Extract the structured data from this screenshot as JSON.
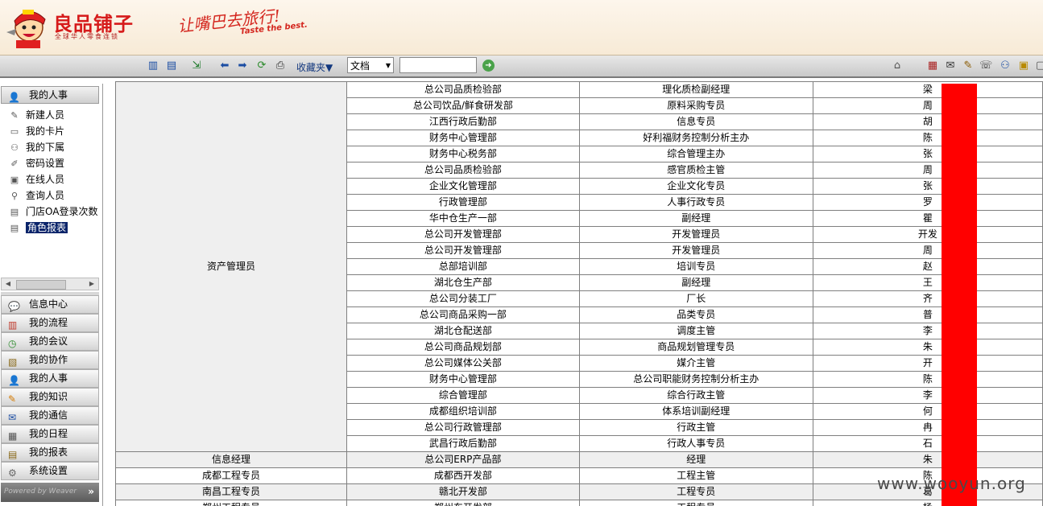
{
  "brand": {
    "logo_text": "良品铺子",
    "logo_subtitle": "全球华人零食连锁",
    "slogan": "让嘴巴去旅行!",
    "slogan_en": "Taste the best."
  },
  "toolbar": {
    "favorites_label": "收藏夹▼",
    "doc_select_value": "文档",
    "search_placeholder": ""
  },
  "sidebar": {
    "tree_header": "我的人事",
    "tree_items": [
      {
        "label": "新建人员",
        "icon": "new-user-icon"
      },
      {
        "label": "我的卡片",
        "icon": "card-icon"
      },
      {
        "label": "我的下属",
        "icon": "subordinate-icon"
      },
      {
        "label": "密码设置",
        "icon": "password-icon"
      },
      {
        "label": "在线人员",
        "icon": "online-icon"
      },
      {
        "label": "查询人员",
        "icon": "search-user-icon"
      },
      {
        "label": "门店OA登录次数",
        "icon": "report-icon"
      },
      {
        "label": "角色报表",
        "icon": "report-icon"
      }
    ],
    "nav_buttons": [
      {
        "label": "信息中心",
        "icon": "chat-icon"
      },
      {
        "label": "我的流程",
        "icon": "flow-icon"
      },
      {
        "label": "我的会议",
        "icon": "meeting-icon"
      },
      {
        "label": "我的协作",
        "icon": "collab-icon"
      },
      {
        "label": "我的人事",
        "icon": "person-icon"
      },
      {
        "label": "我的知识",
        "icon": "knowledge-icon"
      },
      {
        "label": "我的通信",
        "icon": "mail-icon"
      },
      {
        "label": "我的日程",
        "icon": "calendar-icon"
      },
      {
        "label": "我的报表",
        "icon": "report-icon"
      },
      {
        "label": "系统设置",
        "icon": "gear-icon"
      }
    ],
    "footer_text": "Powered by Weaver"
  },
  "table": {
    "group_role": "资产管理员",
    "group_rows": [
      [
        "总公司品质检验部",
        "理化质检副经理",
        "梁"
      ],
      [
        "总公司饮品/鲜食研发部",
        "原料采购专员",
        "周"
      ],
      [
        "江西行政后勤部",
        "信息专员",
        "胡"
      ],
      [
        "财务中心管理部",
        "好利福财务控制分析主办",
        "陈"
      ],
      [
        "财务中心税务部",
        "综合管理主办",
        "张"
      ],
      [
        "总公司品质检验部",
        "感官质检主管",
        "周"
      ],
      [
        "企业文化管理部",
        "企业文化专员",
        "张"
      ],
      [
        "行政管理部",
        "人事行政专员",
        "罗"
      ],
      [
        "华中仓生产一部",
        "副经理",
        "瞿"
      ],
      [
        "总公司开发管理部",
        "开发管理员",
        "开发"
      ],
      [
        "总公司开发管理部",
        "开发管理员",
        "周"
      ],
      [
        "总部培训部",
        "培训专员",
        "赵"
      ],
      [
        "湖北仓生产部",
        "副经理",
        "王"
      ],
      [
        "总公司分装工厂",
        "厂长",
        "齐"
      ],
      [
        "总公司商品采购一部",
        "品类专员",
        "普"
      ],
      [
        "湖北仓配送部",
        "调度主管",
        "李"
      ],
      [
        "总公司商品规划部",
        "商品规划管理专员",
        "朱"
      ],
      [
        "总公司媒体公关部",
        "媒介主管",
        "开"
      ],
      [
        "财务中心管理部",
        "总公司职能财务控制分析主办",
        "陈"
      ],
      [
        "综合管理部",
        "综合行政主管",
        "李"
      ],
      [
        "成都组织培训部",
        "体系培训副经理",
        "何"
      ],
      [
        "总公司行政管理部",
        "行政主管",
        "冉"
      ],
      [
        "武昌行政后勤部",
        "行政人事专员",
        "石"
      ]
    ],
    "other_rows": [
      [
        "信息经理",
        "总公司ERP产品部",
        "经理",
        "朱"
      ],
      [
        "成都工程专员",
        "成都西开发部",
        "工程主管",
        "陈"
      ],
      [
        "南昌工程专员",
        "赣北开发部",
        "工程专员",
        "葛"
      ],
      [
        "郑州工程专员",
        "郑州东开发部",
        "工程专员",
        "杨"
      ]
    ]
  },
  "watermark": "www.wooyun.org"
}
